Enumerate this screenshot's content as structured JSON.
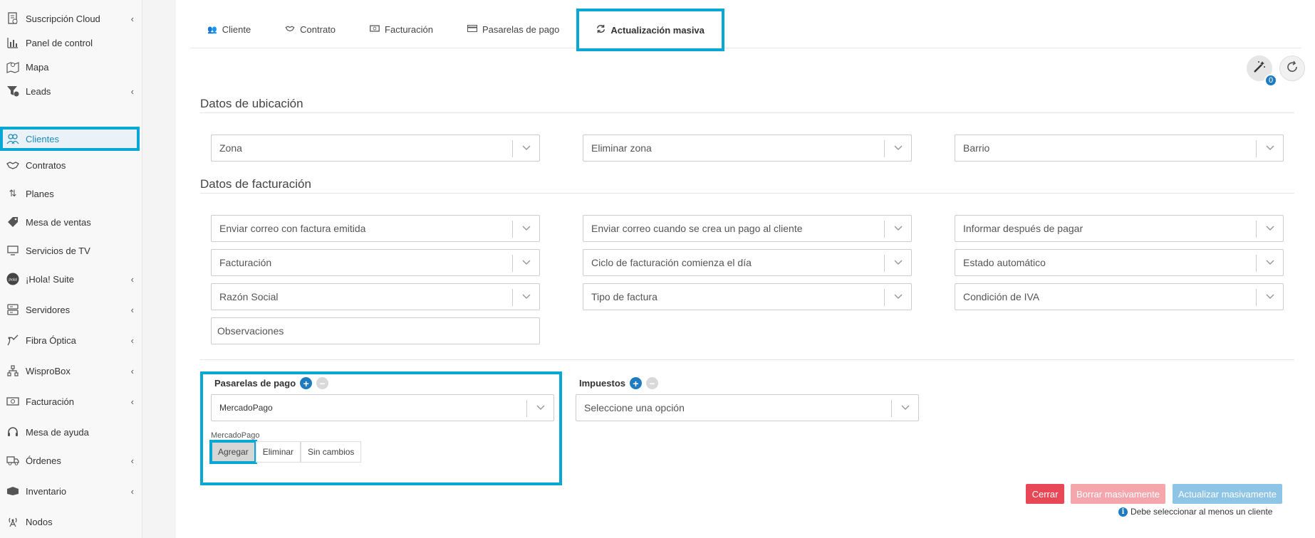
{
  "sidebar": {
    "items": [
      {
        "label": "Suscripción Cloud",
        "icon": "invoice-icon",
        "chevron": true
      },
      {
        "label": "Panel de control",
        "icon": "bar-chart-icon",
        "chevron": false
      },
      {
        "label": "Mapa",
        "icon": "map-icon",
        "chevron": false
      },
      {
        "label": "Leads",
        "icon": "funnel-icon",
        "chevron": true
      },
      {
        "label": "Clientes",
        "icon": "users-icon",
        "chevron": false,
        "active": true
      },
      {
        "label": "Contratos",
        "icon": "handshake-icon",
        "chevron": false
      },
      {
        "label": "Planes",
        "icon": "sort-arrows-icon",
        "chevron": false
      },
      {
        "label": "Mesa de ventas",
        "icon": "tag-icon",
        "chevron": false
      },
      {
        "label": "Servicios de TV",
        "icon": "tv-icon",
        "chevron": false
      },
      {
        "label": "¡Hola! Suite",
        "icon": "hola-logo-icon",
        "chevron": true
      },
      {
        "label": "Servidores",
        "icon": "server-icon",
        "chevron": true
      },
      {
        "label": "Fibra Óptica",
        "icon": "fiber-icon",
        "chevron": true
      },
      {
        "label": "WisproBox",
        "icon": "network-icon",
        "chevron": true
      },
      {
        "label": "Facturación",
        "icon": "money-icon",
        "chevron": true
      },
      {
        "label": "Mesa de ayuda",
        "icon": "headset-icon",
        "chevron": false
      },
      {
        "label": "Órdenes",
        "icon": "truck-icon",
        "chevron": true
      },
      {
        "label": "Inventario",
        "icon": "boxes-icon",
        "chevron": true
      },
      {
        "label": "Nodos",
        "icon": "antenna-icon",
        "chevron": false
      }
    ]
  },
  "tabs": [
    {
      "label": "Cliente",
      "icon": "users-icon"
    },
    {
      "label": "Contrato",
      "icon": "handshake-icon"
    },
    {
      "label": "Facturación",
      "icon": "money-icon"
    },
    {
      "label": "Pasarelas de pago",
      "icon": "credit-card-icon"
    },
    {
      "label": "Actualización masiva",
      "icon": "refresh-icon",
      "active": true
    }
  ],
  "top_actions": {
    "badge_count": "0"
  },
  "ubicacion": {
    "title": "Datos de ubicación",
    "fields": [
      "Zona",
      "Eliminar zona",
      "Barrio"
    ]
  },
  "facturacion": {
    "title": "Datos de facturación",
    "fields": [
      "Enviar correo con factura emitida",
      "Enviar correo cuando se crea un pago al cliente",
      "Informar después de pagar",
      "Facturación",
      "Ciclo de facturación comienza el día",
      "Estado automático",
      "Razón Social",
      "Tipo de factura",
      "Condición de IVA"
    ],
    "observaciones_placeholder": "Observaciones"
  },
  "pasarelas": {
    "label": "Pasarelas de pago",
    "selected": "MercadoPago",
    "sub_label": "MercadoPago",
    "options": [
      "Agregar",
      "Eliminar",
      "Sin cambios"
    ]
  },
  "impuestos": {
    "label": "Impuestos",
    "placeholder": "Seleccione una opción"
  },
  "actions": {
    "close": "Cerrar",
    "delete_bulk": "Borrar masivamente",
    "update_bulk": "Actualizar masivamente",
    "note": "Debe seleccionar al menos un cliente"
  },
  "colors": {
    "accent": "#09a8d4",
    "primary": "#1f7bbf",
    "danger": "#e84856",
    "danger_disabled": "#f5a6ad",
    "info_disabled": "#8ec4e6"
  }
}
